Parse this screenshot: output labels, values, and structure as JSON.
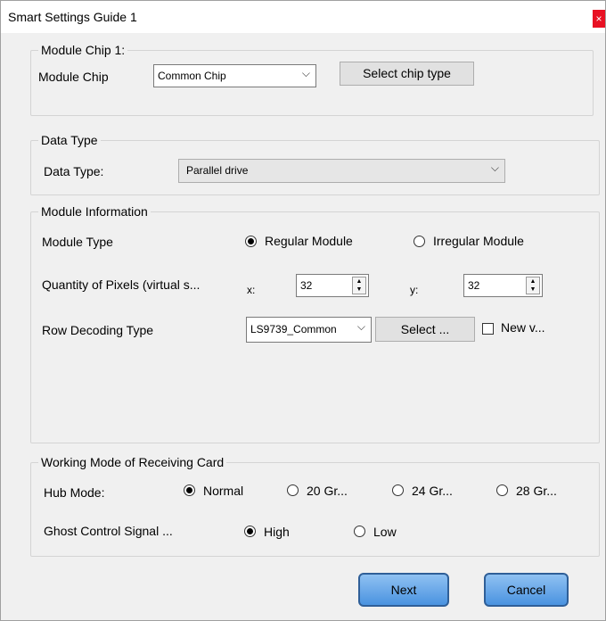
{
  "window": {
    "title": "Smart Settings Guide 1",
    "close_glyph": "×"
  },
  "module_chip_group": {
    "title": "Module Chip 1:",
    "label": "Module Chip",
    "selected": "Common Chip",
    "select_button": "Select chip type"
  },
  "data_type_group": {
    "title": "Data Type",
    "label": "Data Type:",
    "selected": "Parallel drive"
  },
  "module_info_group": {
    "title": "Module Information",
    "module_type_label": "Module Type",
    "regular_label": "Regular Module",
    "irregular_label": "Irregular Module",
    "module_type_selected": "regular",
    "pixels_label": "Quantity of Pixels (virtual s...",
    "x_label": "x:",
    "x_value": "32",
    "y_label": "y:",
    "y_value": "32",
    "row_decoding_label": "Row Decoding Type",
    "row_decoding_selected": "LS9739_Common",
    "select_button": "Select ...",
    "new_version_label": "New v...",
    "new_version_checked": false
  },
  "working_mode_group": {
    "title": "Working Mode of Receiving Card",
    "hub_mode_label": "Hub Mode:",
    "hub_options": [
      "Normal",
      "20 Gr...",
      "24 Gr...",
      "28 Gr..."
    ],
    "hub_selected": "Normal",
    "ghost_label": "Ghost Control Signal ...",
    "ghost_options": [
      "High",
      "Low"
    ],
    "ghost_selected": "High"
  },
  "footer": {
    "next_label": "Next",
    "cancel_label": "Cancel"
  },
  "colors": {
    "close_red": "#e81123",
    "button_blue": "#4a93e0",
    "border_blue": "#2f5f98"
  }
}
